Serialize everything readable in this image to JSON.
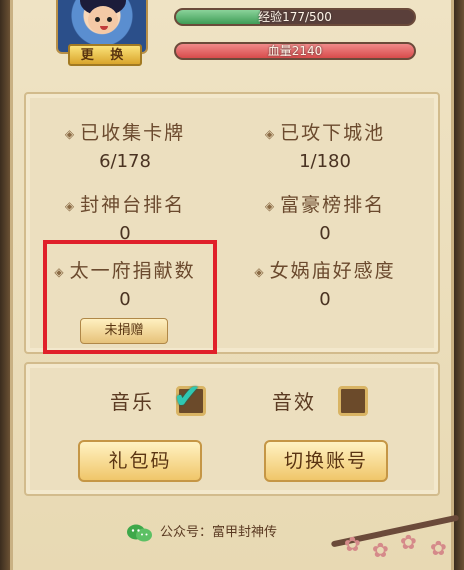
{
  "profile": {
    "change_label": "更 换",
    "exp_text": "经验177/500",
    "exp_progress": 0.354,
    "hp_text": "血量2140",
    "hp_progress": 1.0
  },
  "stats": [
    {
      "label": "已收集卡牌",
      "value": "6/178"
    },
    {
      "label": "已攻下城池",
      "value": "1/180"
    },
    {
      "label": "封神台排名",
      "value": "0"
    },
    {
      "label": "富豪榜排名",
      "value": "0"
    },
    {
      "label": "太一府捐献数",
      "value": "0"
    },
    {
      "label": "女娲庙好感度",
      "value": "0"
    }
  ],
  "donate_button": "未捐赠",
  "settings": {
    "music_label": "音乐",
    "music_checked": true,
    "sfx_label": "音效",
    "sfx_checked": false,
    "gift_code_button": "礼包码",
    "switch_account_button": "切换账号"
  },
  "footer": {
    "text": "公众号：富甲封神传"
  },
  "colors": {
    "exp_fill": "#3f9c57",
    "hp_fill": "#d84c4c",
    "highlight_border": "#e0202a",
    "check_mark": "#2fc7b2"
  }
}
